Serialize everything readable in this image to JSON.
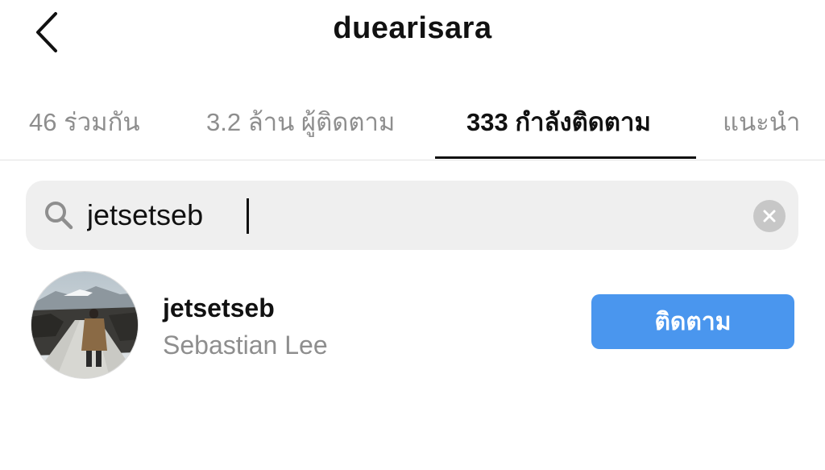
{
  "header": {
    "title": "duearisara",
    "back_icon": "chevron-left-icon"
  },
  "tabs": [
    {
      "label": "46 ร่วมกัน",
      "active": false
    },
    {
      "label": "3.2 ล้าน ผู้ติดตาม",
      "active": false
    },
    {
      "label": "333 กำลังติดตาม",
      "active": true
    },
    {
      "label": "แนะนำ",
      "active": false
    }
  ],
  "search": {
    "value": "jetsetseb",
    "placeholder": "",
    "icon": "search-icon",
    "clear_icon": "clear-icon"
  },
  "results": [
    {
      "username": "jetsetseb",
      "full_name": "Sebastian Lee",
      "action_label": "ติดตาม"
    }
  ],
  "colors": {
    "accent": "#4a96ee",
    "primary_text": "#111111",
    "secondary_text": "#8e8e8e",
    "search_bg": "#efefef"
  }
}
